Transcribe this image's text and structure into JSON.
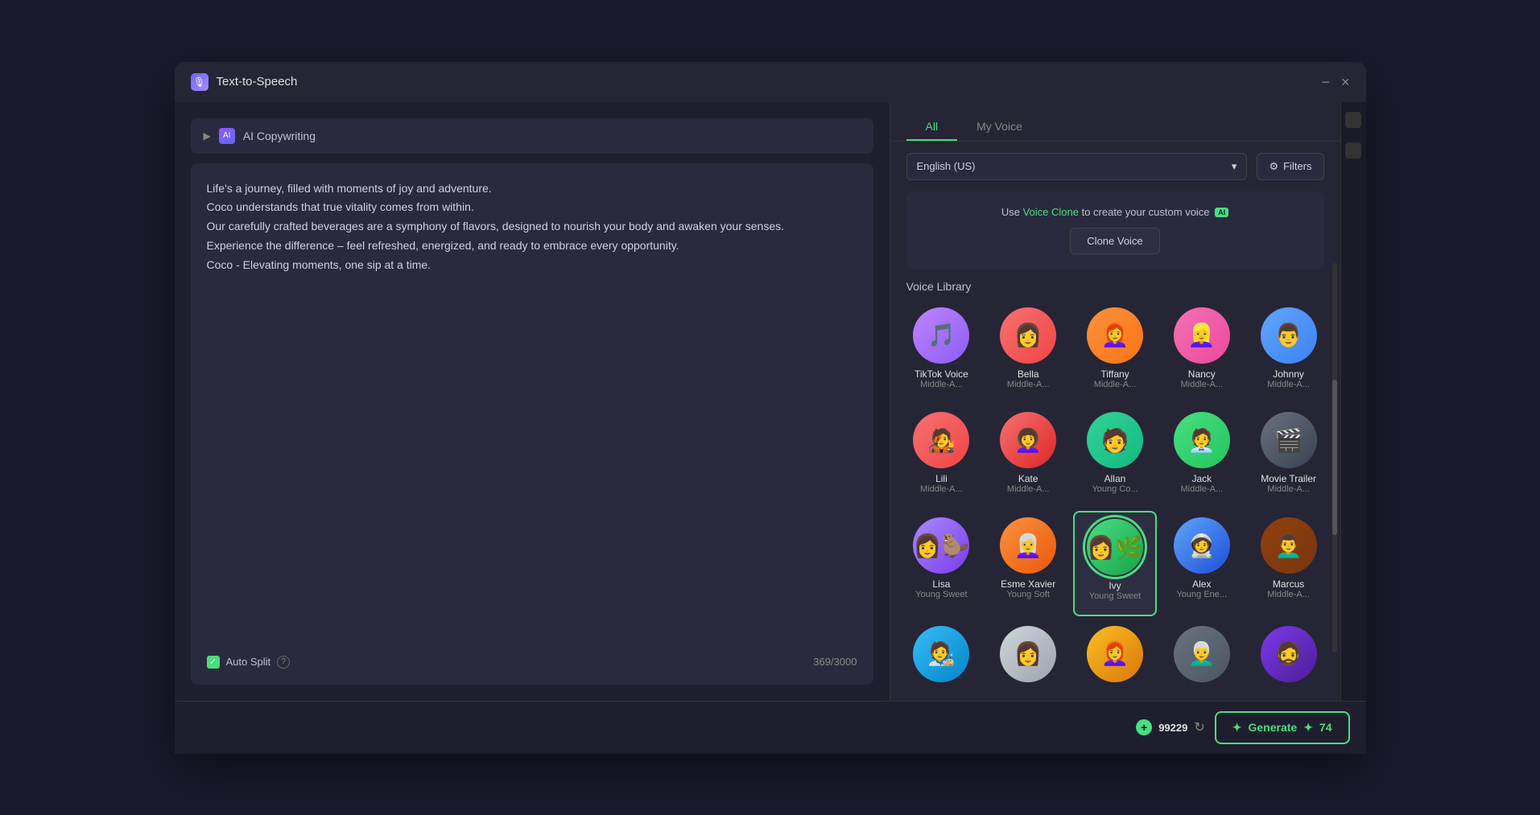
{
  "window": {
    "title": "Text-to-Speech",
    "minimize_label": "−",
    "close_label": "×"
  },
  "tabs": {
    "all_label": "All",
    "my_voice_label": "My Voice"
  },
  "language": {
    "selected": "English (US)"
  },
  "filters": {
    "label": "Filters"
  },
  "clone_voice": {
    "section_label": "Clone Voice",
    "description_prefix": "Use ",
    "link_text": "Voice Clone",
    "description_suffix": " to create your custom voice",
    "ai_badge": "AI",
    "button_label": "Clone Voice"
  },
  "voice_library": {
    "label": "Voice Library",
    "voices": [
      {
        "name": "TikTok Voice",
        "sub": "Middle-A...",
        "avatar_class": "av-tiktok"
      },
      {
        "name": "Bella",
        "sub": "Middle-A...",
        "avatar_class": "av-bella"
      },
      {
        "name": "Tiffany",
        "sub": "Middle-A...",
        "avatar_class": "av-tiffany"
      },
      {
        "name": "Nancy",
        "sub": "Middle-A...",
        "avatar_class": "av-nancy"
      },
      {
        "name": "Johnny",
        "sub": "Middle-A...",
        "avatar_class": "av-johnny"
      },
      {
        "name": "Lili",
        "sub": "Middle-A...",
        "avatar_class": "av-lili"
      },
      {
        "name": "Kate",
        "sub": "Middle-A...",
        "avatar_class": "av-kate"
      },
      {
        "name": "Allan",
        "sub": "Young Co...",
        "avatar_class": "av-allan"
      },
      {
        "name": "Jack",
        "sub": "Middle-A...",
        "avatar_class": "av-jack"
      },
      {
        "name": "Movie Trailer",
        "sub": "Middle-A...",
        "avatar_class": "av-movie"
      },
      {
        "name": "Lisa",
        "sub": "Young Sweet",
        "avatar_class": "av-lisa"
      },
      {
        "name": "Esme Xavier",
        "sub": "Young Soft",
        "avatar_class": "av-esme"
      },
      {
        "name": "Ivy",
        "sub": "Young Sweet",
        "avatar_class": "av-ivy",
        "selected": true
      },
      {
        "name": "Alex",
        "sub": "Young Ene...",
        "avatar_class": "av-alex"
      },
      {
        "name": "Marcus",
        "sub": "Middle-A...",
        "avatar_class": "av-marcus"
      },
      {
        "name": "",
        "sub": "",
        "avatar_class": "av-r1"
      },
      {
        "name": "",
        "sub": "",
        "avatar_class": "av-r2"
      },
      {
        "name": "",
        "sub": "",
        "avatar_class": "av-r3"
      },
      {
        "name": "",
        "sub": "",
        "avatar_class": "av-r4"
      },
      {
        "name": "",
        "sub": "",
        "avatar_class": "av-r5"
      }
    ]
  },
  "editor": {
    "text": "Life's a journey, filled with moments of joy and adventure.\nCoco understands that true vitality comes from within.\nOur carefully crafted beverages are a symphony of flavors, designed to nourish your body and awaken your senses.\nExperience the difference – feel refreshed, energized, and ready to embrace every opportunity.\nCoco - Elevating moments, one sip at a time.",
    "auto_split_label": "Auto Split",
    "char_count": "369/3000"
  },
  "ai_copywriting": {
    "label": "AI Copywriting"
  },
  "bottom_bar": {
    "credits": "99229",
    "generate_label": "Generate",
    "generate_count": "74"
  }
}
